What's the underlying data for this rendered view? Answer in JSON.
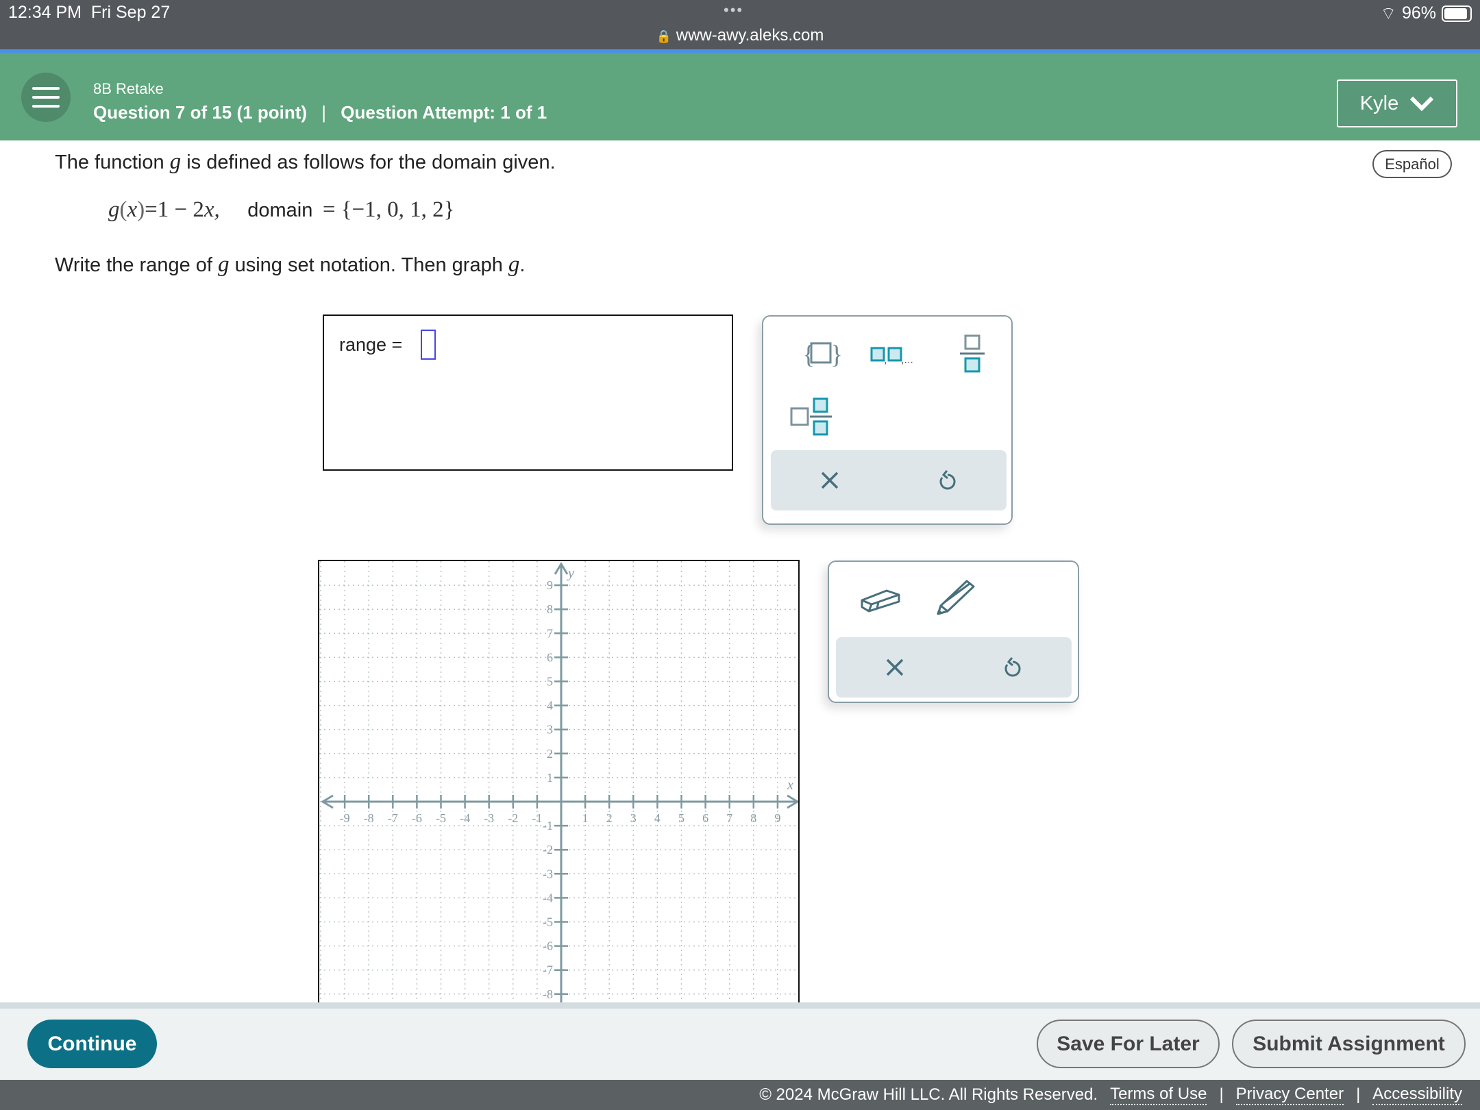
{
  "status_bar": {
    "time": "12:34 PM  Fri Sep 27",
    "dots": "•••",
    "url": "www-awy.aleks.com",
    "battery": "96%",
    "battery_level": 0.96
  },
  "header": {
    "course": "8B Retake",
    "question": "Question 7 of 15 (1 point)",
    "separator": "|",
    "attempt": "Question Attempt: 1 of 1",
    "user": "Kyle"
  },
  "language_button": "Español",
  "problem": {
    "intro_pre": "The function ",
    "intro_var": "g",
    "intro_post": " is defined as follows for the domain given.",
    "formula_lhs": "g",
    "formula_x": "x",
    "formula_rhs": "=1 − 2",
    "formula_rhs_x": "x,",
    "domain_label": "domain",
    "domain_set": "= {−1, 0, 1, 2}",
    "task_pre": "Write the range of ",
    "task_var": "g",
    "task_mid": " using set notation. Then graph ",
    "task_var2": "g",
    "task_end": "."
  },
  "answer": {
    "label": "range =",
    "value": ""
  },
  "keypad": {
    "buttons": [
      "set-braces",
      "list",
      "fraction",
      "mixed-number"
    ],
    "clear": "clear",
    "undo": "undo"
  },
  "graph_tools": {
    "buttons": [
      "eraser",
      "pencil"
    ],
    "clear": "clear",
    "undo": "undo"
  },
  "graph": {
    "x_label": "x",
    "y_label": "y",
    "xmin": -9,
    "xmax": 9,
    "ymin": -8,
    "ymax": 9,
    "grid": true,
    "axis_color": "#7e9aa0"
  },
  "bottom": {
    "continue": "Continue",
    "save": "Save For Later",
    "submit": "Submit Assignment"
  },
  "footer": {
    "copyright": "© 2024 McGraw Hill LLC. All Rights Reserved.",
    "terms": "Terms of Use",
    "privacy": "Privacy Center",
    "accessibility": "Accessibility",
    "sep": "|"
  },
  "colors": {
    "header": "#5fa57d",
    "continue": "#0c7086",
    "status": "#54575b"
  }
}
